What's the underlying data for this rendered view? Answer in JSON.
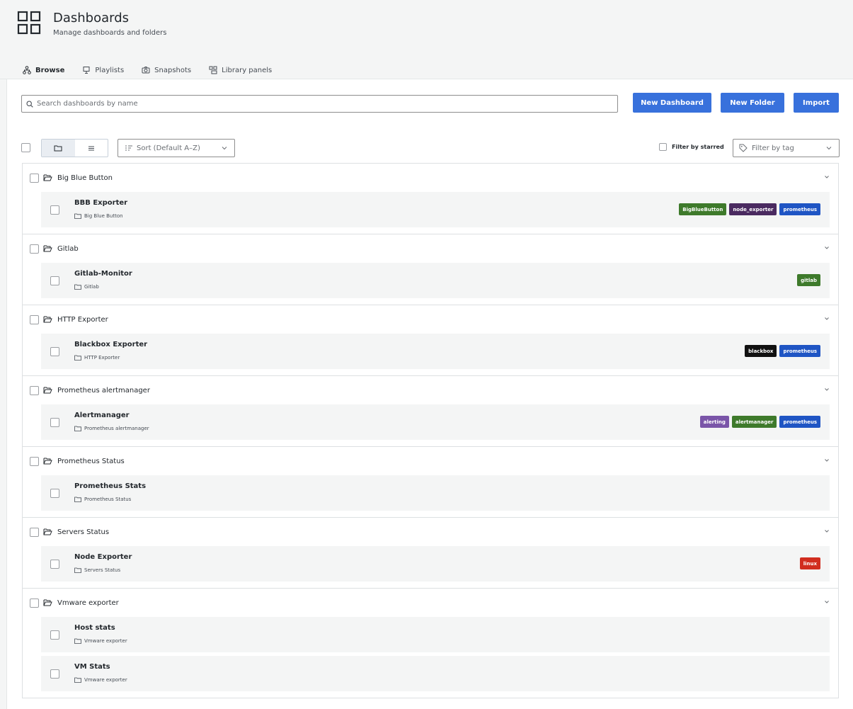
{
  "header": {
    "title": "Dashboards",
    "subtitle": "Manage dashboards and folders",
    "icon": "apps-grid-icon"
  },
  "tabs": [
    {
      "label": "Browse",
      "icon": "sitemap-icon",
      "active": true
    },
    {
      "label": "Playlists",
      "icon": "presentation-icon",
      "active": false
    },
    {
      "label": "Snapshots",
      "icon": "camera-icon",
      "active": false
    },
    {
      "label": "Library panels",
      "icon": "library-panels-icon",
      "active": false
    }
  ],
  "search": {
    "placeholder": "Search dashboards by name",
    "value": ""
  },
  "actions": {
    "new_dashboard": "New Dashboard",
    "new_folder": "New Folder",
    "import": "Import"
  },
  "toolbar": {
    "sort": "Sort (Default A–Z)",
    "filter_starred": "Filter by starred",
    "filter_tag": "Filter by tag"
  },
  "colors": {
    "primary_button": "#3871dc",
    "tab_underline_start": "#f05a28",
    "tab_underline_end": "#fbca0a"
  },
  "folders": [
    {
      "name": "Big Blue Button",
      "dashboards": [
        {
          "title": "BBB Exporter",
          "folder": "Big Blue Button",
          "tags": [
            {
              "label": "BigBlueButton",
              "color": "#3e7a2b"
            },
            {
              "label": "node_exporter",
              "color": "#4a2a60"
            },
            {
              "label": "prometheus",
              "color": "#1f55c4"
            }
          ]
        }
      ]
    },
    {
      "name": "Gitlab",
      "dashboards": [
        {
          "title": "Gitlab-Monitor",
          "folder": "Gitlab",
          "tags": [
            {
              "label": "gitlab",
              "color": "#3e7a2b"
            }
          ]
        }
      ]
    },
    {
      "name": "HTTP Exporter",
      "dashboards": [
        {
          "title": "Blackbox Exporter",
          "folder": "HTTP Exporter",
          "tags": [
            {
              "label": "blackbox",
              "color": "#111111"
            },
            {
              "label": "prometheus",
              "color": "#1f55c4"
            }
          ]
        }
      ]
    },
    {
      "name": "Prometheus alertmanager",
      "dashboards": [
        {
          "title": "Alertmanager",
          "folder": "Prometheus alertmanager",
          "tags": [
            {
              "label": "alerting",
              "color": "#7a55a8"
            },
            {
              "label": "alertmanager",
              "color": "#3e7a2b"
            },
            {
              "label": "prometheus",
              "color": "#1f55c4"
            }
          ]
        }
      ]
    },
    {
      "name": "Prometheus Status",
      "dashboards": [
        {
          "title": "Prometheus Stats",
          "folder": "Prometheus Status",
          "tags": []
        }
      ]
    },
    {
      "name": "Servers Status",
      "dashboards": [
        {
          "title": "Node Exporter",
          "folder": "Servers Status",
          "tags": [
            {
              "label": "linux",
              "color": "#d12d1f"
            }
          ]
        }
      ]
    },
    {
      "name": "Vmware exporter",
      "dashboards": [
        {
          "title": "Host stats",
          "folder": "Vmware exporter",
          "tags": []
        },
        {
          "title": "VM Stats",
          "folder": "Vmware exporter",
          "tags": []
        }
      ]
    }
  ]
}
